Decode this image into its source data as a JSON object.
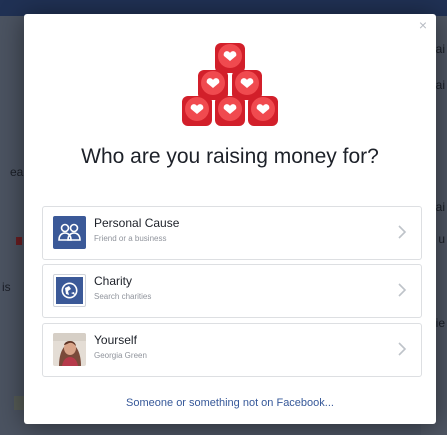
{
  "background": {
    "fragments": [
      "ai",
      "ai",
      "ea",
      "is",
      "ai",
      "u",
      "ie"
    ]
  },
  "modal": {
    "close_label": "×",
    "title": "Who are you raising money for?",
    "options": [
      {
        "label": "Personal Cause",
        "sublabel": "Friend or a business",
        "icon": "people-icon"
      },
      {
        "label": "Charity",
        "sublabel": "Search charities",
        "icon": "globe-icon"
      },
      {
        "label": "Yourself",
        "sublabel": "Georgia Green",
        "icon": "avatar"
      }
    ],
    "footer_link": "Someone or something not on Facebook..."
  },
  "colors": {
    "facebook_blue": "#3b5998",
    "link_blue": "#365899",
    "hero_red": "#e8212e"
  }
}
